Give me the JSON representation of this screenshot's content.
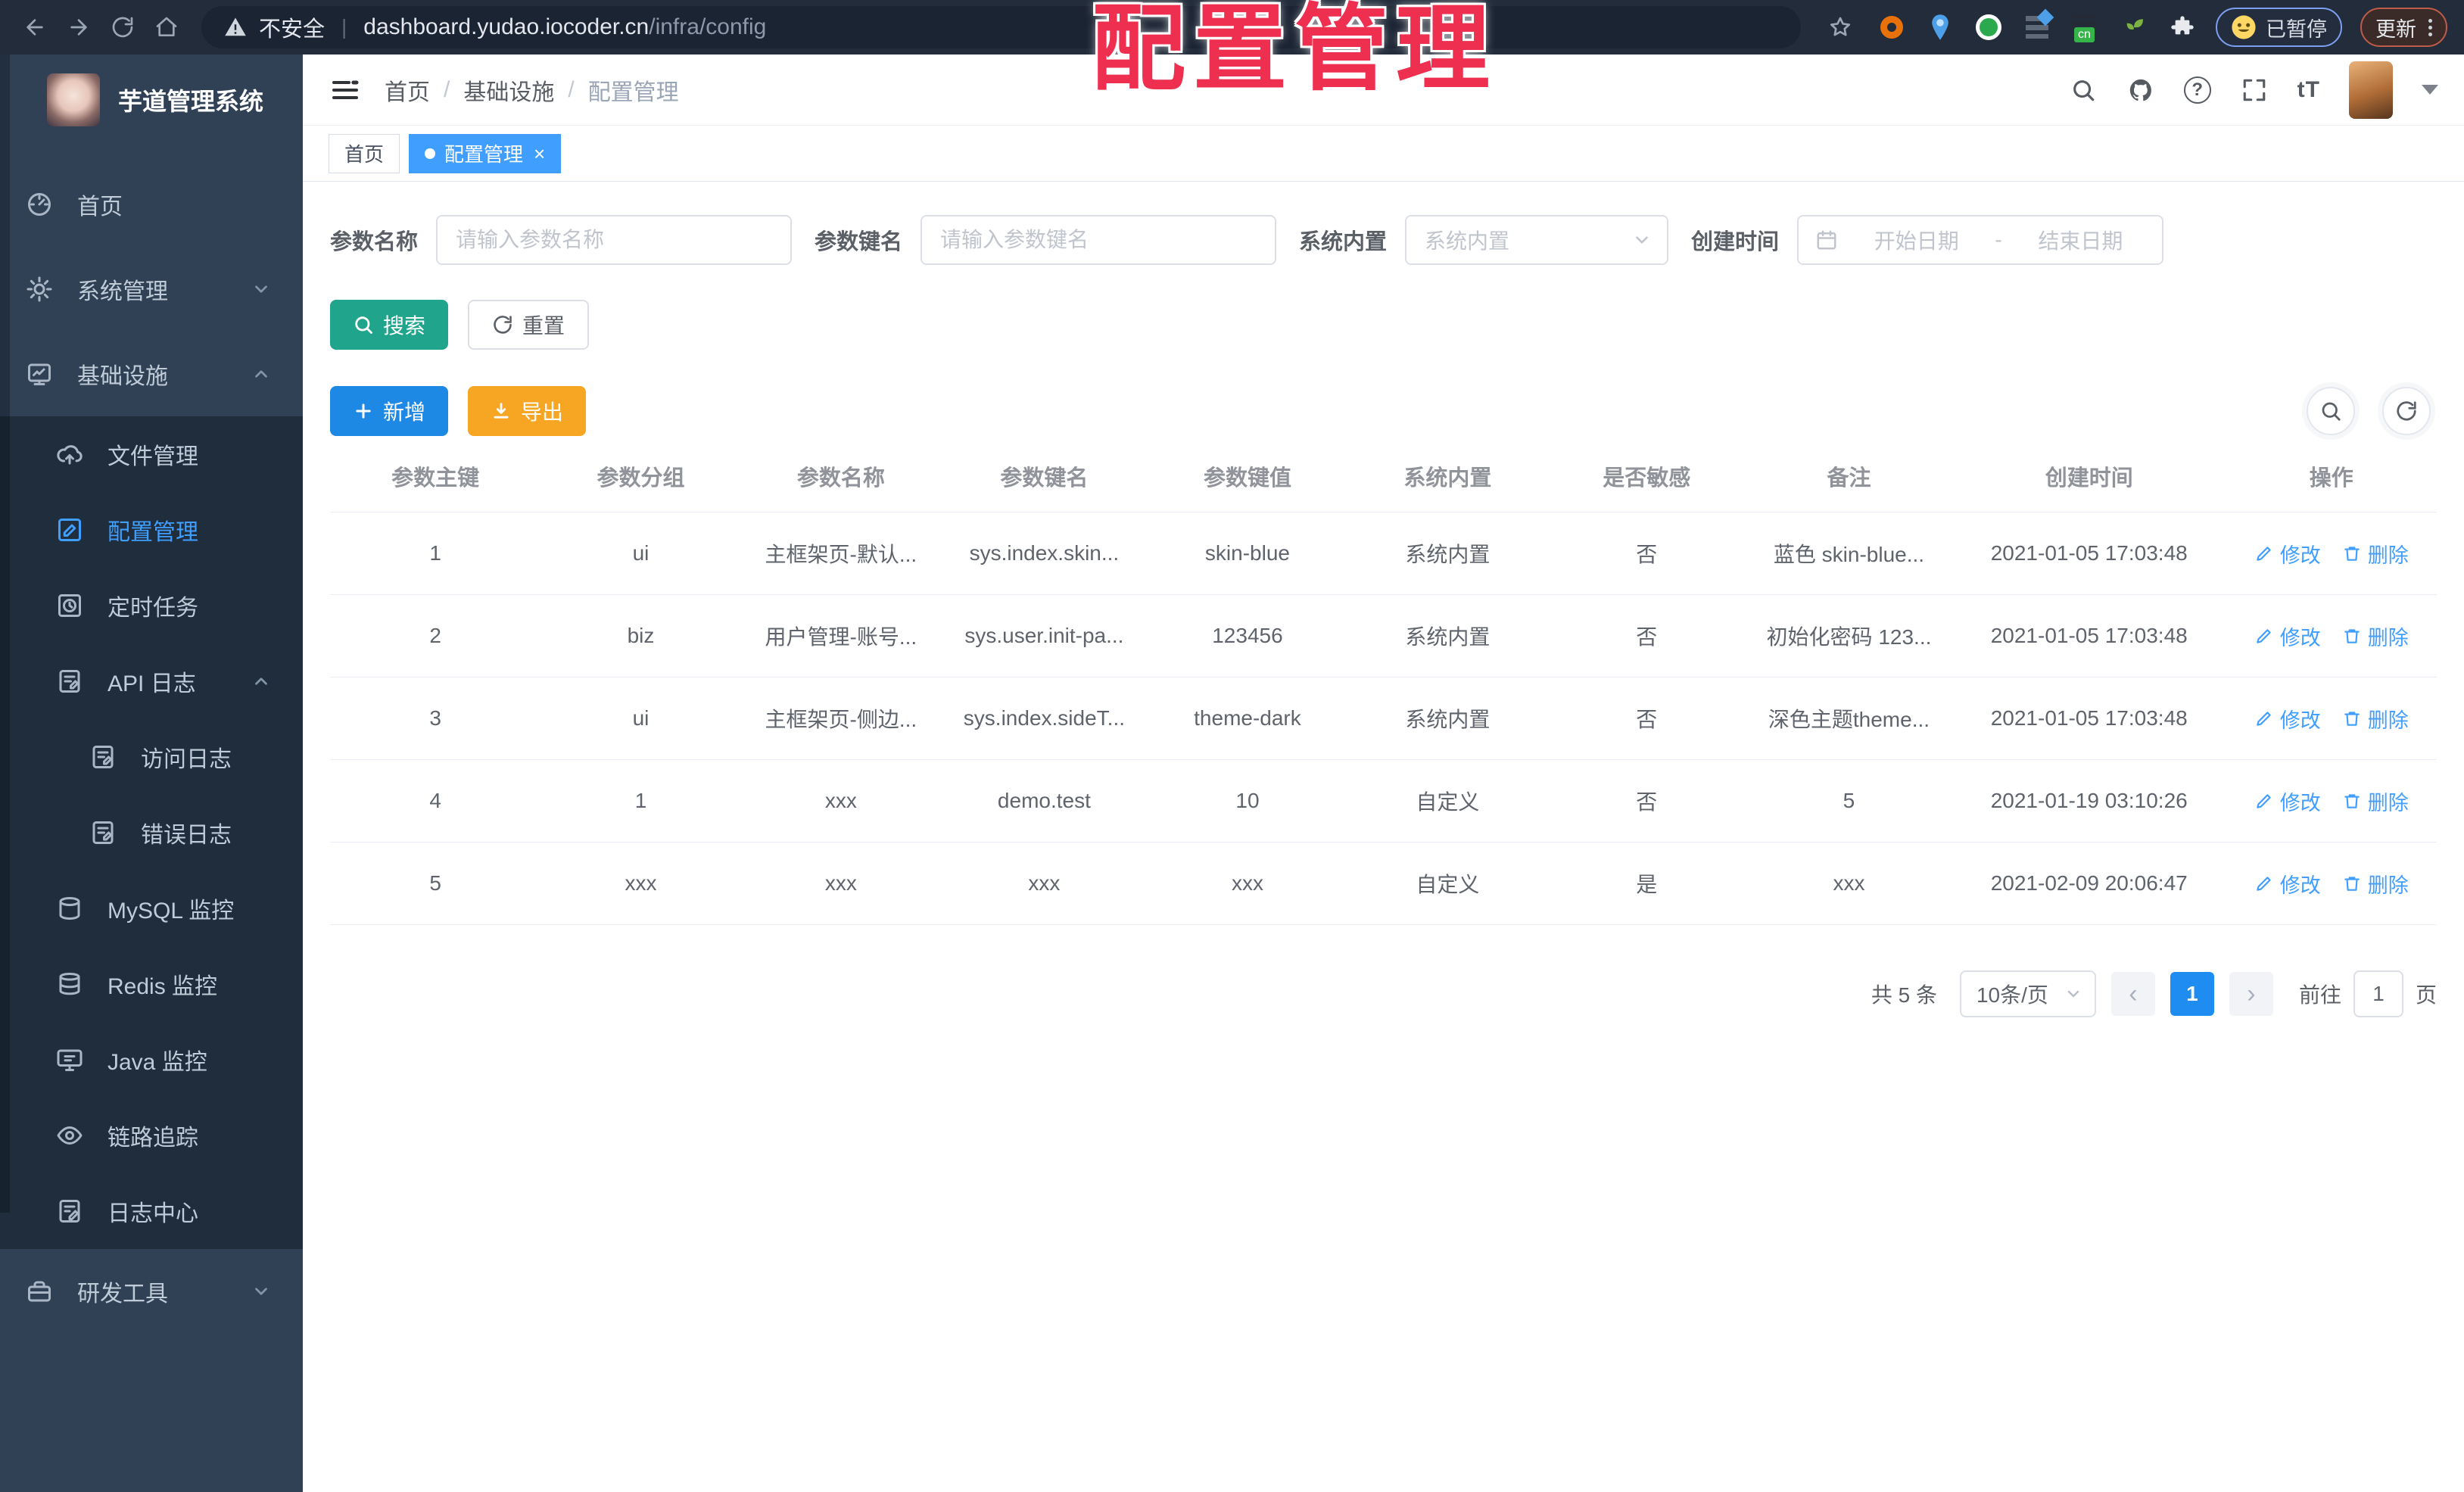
{
  "browser": {
    "security_label": "不安全",
    "divider": "|",
    "url_host": "dashboard.yudao.iocoder.cn",
    "url_path": "/infra/config",
    "ext_cn_label": "cn",
    "paused_badge": "已暂停",
    "update_label": "更新"
  },
  "annotation": {
    "text": "配置管理"
  },
  "sidebar": {
    "title": "芋道管理系统",
    "items": {
      "home": "首页",
      "system": "系统管理",
      "infra": "基础设施",
      "file": "文件管理",
      "config": "配置管理",
      "job": "定时任务",
      "api_log": "API 日志",
      "access_log": "访问日志",
      "error_log": "错误日志",
      "mysql": "MySQL 监控",
      "redis": "Redis 监控",
      "java": "Java 监控",
      "tracing": "链路追踪",
      "log_center": "日志中心",
      "dev_tools": "研发工具"
    }
  },
  "header": {
    "breadcrumb": [
      "首页",
      "基础设施",
      "配置管理"
    ],
    "breadcrumb_separator": "/",
    "help_glyph": "?",
    "font_size_icon": "tT"
  },
  "tabs": {
    "home": "首页",
    "config": "配置管理",
    "close": "×"
  },
  "filters": {
    "name": {
      "label": "参数名称",
      "placeholder": "请输入参数名称"
    },
    "key": {
      "label": "参数键名",
      "placeholder": "请输入参数键名"
    },
    "builtin": {
      "label": "系统内置",
      "placeholder": "系统内置"
    },
    "created": {
      "label": "创建时间",
      "start_placeholder": "开始日期",
      "separator": "-",
      "end_placeholder": "结束日期"
    }
  },
  "actions": {
    "search": "搜索",
    "reset": "重置",
    "add": "新增",
    "export": "导出"
  },
  "table": {
    "columns": [
      "参数主键",
      "参数分组",
      "参数名称",
      "参数键名",
      "参数键值",
      "系统内置",
      "是否敏感",
      "备注",
      "创建时间",
      "操作"
    ],
    "row_actions": {
      "edit": "修改",
      "delete": "删除"
    },
    "rows": [
      {
        "id": "1",
        "group": "ui",
        "name": "主框架页-默认...",
        "key": "sys.index.skin...",
        "value": "skin-blue",
        "builtin": "系统内置",
        "sensitive": "否",
        "remark": "蓝色 skin-blue...",
        "created": "2021-01-05 17:03:48"
      },
      {
        "id": "2",
        "group": "biz",
        "name": "用户管理-账号...",
        "key": "sys.user.init-pa...",
        "value": "123456",
        "builtin": "系统内置",
        "sensitive": "否",
        "remark": "初始化密码 123...",
        "created": "2021-01-05 17:03:48"
      },
      {
        "id": "3",
        "group": "ui",
        "name": "主框架页-侧边...",
        "key": "sys.index.sideT...",
        "value": "theme-dark",
        "builtin": "系统内置",
        "sensitive": "否",
        "remark": "深色主题theme...",
        "created": "2021-01-05 17:03:48"
      },
      {
        "id": "4",
        "group": "1",
        "name": "xxx",
        "key": "demo.test",
        "value": "10",
        "builtin": "自定义",
        "sensitive": "否",
        "remark": "5",
        "created": "2021-01-19 03:10:26"
      },
      {
        "id": "5",
        "group": "xxx",
        "name": "xxx",
        "key": "xxx",
        "value": "xxx",
        "builtin": "自定义",
        "sensitive": "是",
        "remark": "xxx",
        "created": "2021-02-09 20:06:47"
      }
    ]
  },
  "pagination": {
    "total": "共 5 条",
    "page_size": "10条/页",
    "prev": "‹",
    "current": "1",
    "next": "›",
    "goto_label": "前往",
    "goto_value": "1",
    "unit": "页"
  },
  "colors": {
    "primary_blue": "#1e88e5",
    "active_link": "#409eff",
    "search_teal": "#21a48c",
    "export_amber": "#f6a622",
    "sidebar_bg": "#304156",
    "submenu_bg": "#1f2d3d",
    "annotation_red": "#ee2f50"
  }
}
